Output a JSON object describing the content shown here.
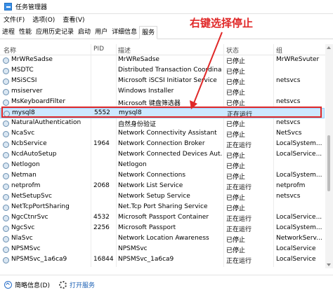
{
  "window": {
    "title": "任务管理器"
  },
  "menu": [
    "文件(F)",
    "选项(O)",
    "查看(V)"
  ],
  "tabs": [
    "进程",
    "性能",
    "应用历史记录",
    "启动",
    "用户",
    "详细信息",
    "服务"
  ],
  "active_tab": 6,
  "columns": {
    "name": "名称",
    "pid": "PID",
    "desc": "描述",
    "status": "状态",
    "group": "组"
  },
  "rows": [
    {
      "name": "MrWReSadse",
      "pid": "",
      "desc": "MrWReSadse",
      "status": "已停止",
      "group": "MrWReSvuter"
    },
    {
      "name": "MSDTC",
      "pid": "",
      "desc": "Distributed Transaction Coordina...",
      "status": "已停止",
      "group": ""
    },
    {
      "name": "MSiSCSI",
      "pid": "",
      "desc": "Microsoft iSCSI Initiator Service",
      "status": "已停止",
      "group": "netsvcs"
    },
    {
      "name": "msiserver",
      "pid": "",
      "desc": "Windows Installer",
      "status": "已停止",
      "group": ""
    },
    {
      "name": "MsKeyboardFilter",
      "pid": "",
      "desc": "Microsoft 键盘筛选器",
      "status": "已停止",
      "group": "netsvcs"
    },
    {
      "name": "mysql8",
      "pid": "5552",
      "desc": "mysql8",
      "status": "正在运行",
      "group": ""
    },
    {
      "name": "NaturalAuthentication",
      "pid": "",
      "desc": "自然身份验证",
      "status": "已停止",
      "group": "netsvcs"
    },
    {
      "name": "NcaSvc",
      "pid": "",
      "desc": "Network Connectivity Assistant",
      "status": "已停止",
      "group": "NetSvcs"
    },
    {
      "name": "NcbService",
      "pid": "1964",
      "desc": "Network Connection Broker",
      "status": "正在运行",
      "group": "LocalSystem..."
    },
    {
      "name": "NcdAutoSetup",
      "pid": "",
      "desc": "Network Connected Devices Aut...",
      "status": "已停止",
      "group": "LocalService..."
    },
    {
      "name": "Netlogon",
      "pid": "",
      "desc": "Netlogon",
      "status": "已停止",
      "group": ""
    },
    {
      "name": "Netman",
      "pid": "",
      "desc": "Network Connections",
      "status": "已停止",
      "group": "LocalSystem..."
    },
    {
      "name": "netprofm",
      "pid": "2068",
      "desc": "Network List Service",
      "status": "正在运行",
      "group": "netprofm"
    },
    {
      "name": "NetSetupSvc",
      "pid": "",
      "desc": "Network Setup Service",
      "status": "已停止",
      "group": "netsvcs"
    },
    {
      "name": "NetTcpPortSharing",
      "pid": "",
      "desc": "Net.Tcp Port Sharing Service",
      "status": "已停止",
      "group": ""
    },
    {
      "name": "NgcCtnrSvc",
      "pid": "4532",
      "desc": "Microsoft Passport Container",
      "status": "正在运行",
      "group": "LocalService..."
    },
    {
      "name": "NgcSvc",
      "pid": "2256",
      "desc": "Microsoft Passport",
      "status": "正在运行",
      "group": "LocalSystem..."
    },
    {
      "name": "NlaSvc",
      "pid": "",
      "desc": "Network Location Awareness",
      "status": "已停止",
      "group": "NetworkServ..."
    },
    {
      "name": "NPSMSvc",
      "pid": "",
      "desc": "NPSMSvc",
      "status": "已停止",
      "group": "LocalService"
    },
    {
      "name": "NPSMSvc_1a6ca9",
      "pid": "16844",
      "desc": "NPSMSvc_1a6ca9",
      "status": "正在运行",
      "group": "LocalService"
    }
  ],
  "selected_row": 5,
  "statusbar": {
    "fewer_details": "简略信息(D)",
    "open_services": "打开服务"
  },
  "annotation": {
    "text": "右键选择停止",
    "color": "#e02828"
  }
}
